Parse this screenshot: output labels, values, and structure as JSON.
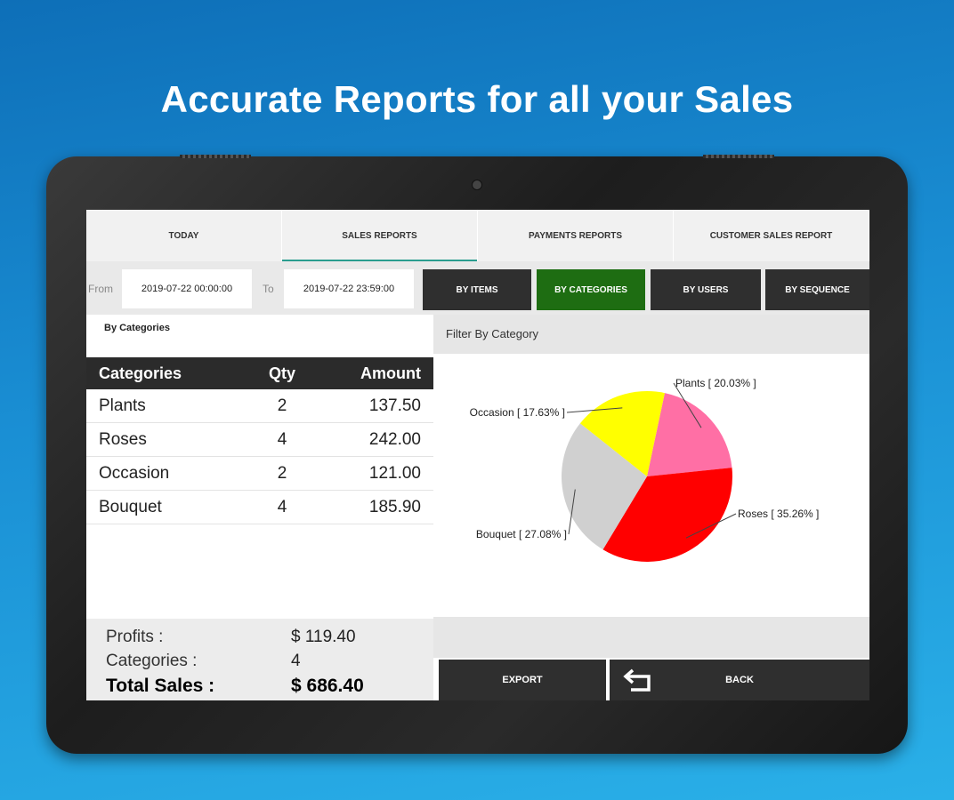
{
  "headline": "Accurate Reports for all your Sales",
  "tabs": [
    {
      "label": "TODAY",
      "active": false
    },
    {
      "label": "SALES REPORTS",
      "active": true
    },
    {
      "label": "PAYMENTS REPORTS",
      "active": false
    },
    {
      "label": "CUSTOMER SALES REPORT",
      "active": false
    }
  ],
  "filter": {
    "from_label": "From",
    "from_value": "2019-07-22 00:00:00",
    "to_label": "To",
    "to_value": "2019-07-22 23:59:00",
    "buttons": [
      {
        "label": "BY ITEMS",
        "active": false
      },
      {
        "label": "BY CATEGORIES",
        "active": true
      },
      {
        "label": "BY USERS",
        "active": false
      },
      {
        "label": "BY SEQUENCE",
        "active": false
      }
    ]
  },
  "section_title": "By Categories",
  "table": {
    "headers": [
      "Categories",
      "Qty",
      "Amount"
    ],
    "rows": [
      [
        "Plants",
        "2",
        "137.50"
      ],
      [
        "Roses",
        "4",
        "242.00"
      ],
      [
        "Occasion",
        "2",
        "121.00"
      ],
      [
        "Bouquet",
        "4",
        "185.90"
      ]
    ]
  },
  "summary": {
    "profits_label": "Profits :",
    "profits_value": "$ 119.40",
    "categories_label": "Categories :",
    "categories_value": "4",
    "total_label": "Total Sales :",
    "total_value": "$ 686.40"
  },
  "chart_header": "Filter By Category",
  "chart_data": {
    "type": "pie",
    "title": "",
    "slices": [
      {
        "label": "Plants",
        "percent_label": "[ 20.03% ]",
        "value": 20.03,
        "color": "#ff6fa5"
      },
      {
        "label": "Roses",
        "percent_label": "[ 35.26% ]",
        "value": 35.26,
        "color": "#ff0000"
      },
      {
        "label": "Bouquet",
        "percent_label": "[ 27.08% ]",
        "value": 27.08,
        "color": "#d0d0d0"
      },
      {
        "label": "Occasion",
        "percent_label": "[ 17.63% ]",
        "value": 17.63,
        "color": "#ffff00"
      }
    ]
  },
  "buttons": {
    "export": "EXPORT",
    "back": "BACK"
  },
  "icons": {
    "back": "back-arrow-icon"
  }
}
